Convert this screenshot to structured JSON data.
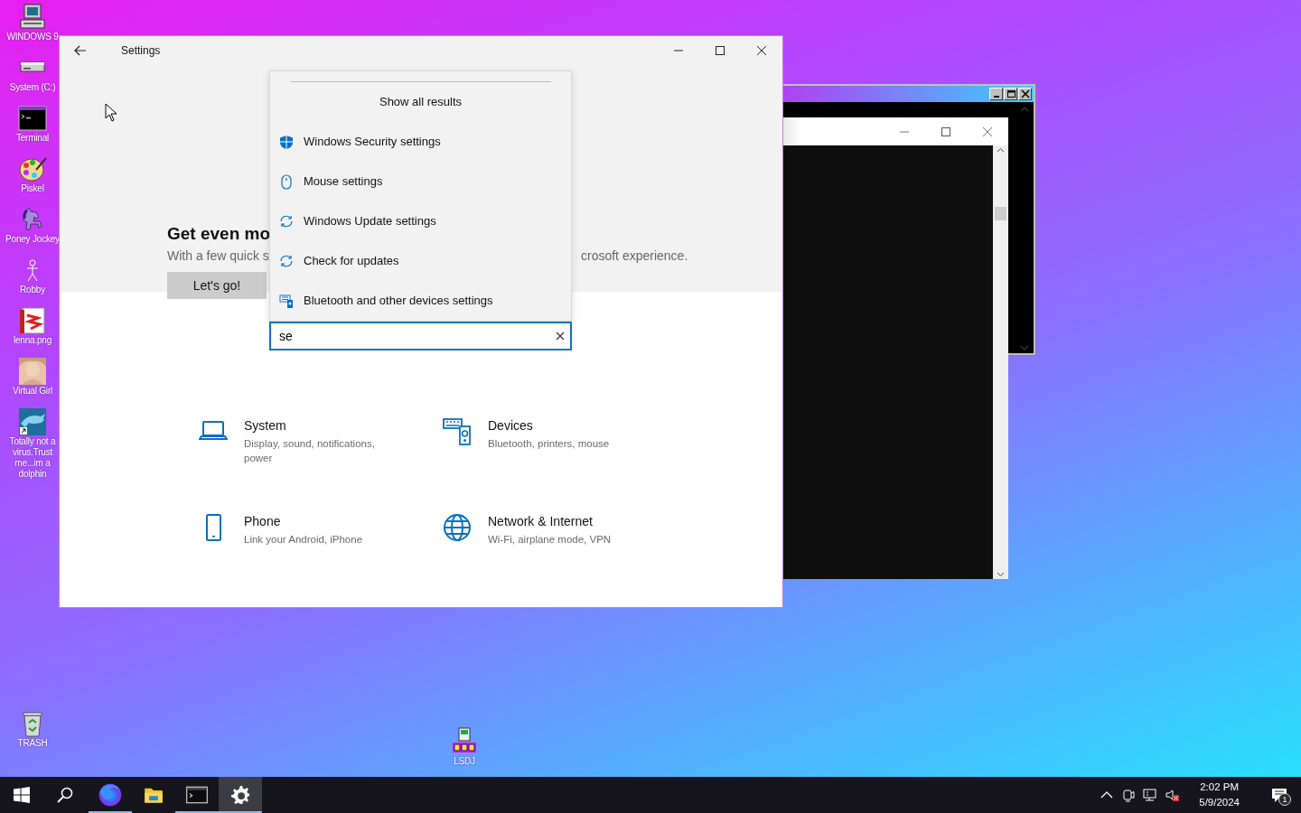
{
  "desktop_icons": [
    {
      "label": "WINDOWS 9",
      "kind": "computer"
    },
    {
      "label": "System (C:)",
      "kind": "drive"
    },
    {
      "label": "Terminal",
      "kind": "terminal"
    },
    {
      "label": "Piskel",
      "kind": "palette"
    },
    {
      "label": "Poney Jockey",
      "kind": "horse"
    },
    {
      "label": "Robby",
      "kind": "stick"
    },
    {
      "label": "lenna.png",
      "kind": "image"
    },
    {
      "label": "Virtual Girl",
      "kind": "person"
    },
    {
      "label": "Totally not a virus.Trust me...im a dolphin",
      "kind": "dolphin"
    }
  ],
  "bottom_icons": [
    {
      "label": "TRASH",
      "kind": "trash"
    },
    {
      "label": "LSDJ",
      "kind": "gameboy"
    }
  ],
  "settings": {
    "title": "Settings",
    "banner": {
      "heading": "Get even mo",
      "text_left": "With a few quick s",
      "text_right": "crosoft experience.",
      "button": "Let's go!"
    },
    "search": {
      "value": "se"
    },
    "results_header": "Show all results",
    "results": [
      {
        "label": "Windows Security settings",
        "kind": "shield"
      },
      {
        "label": "Mouse settings",
        "kind": "mouse"
      },
      {
        "label": "Windows Update settings",
        "kind": "sync"
      },
      {
        "label": "Check for updates",
        "kind": "sync"
      },
      {
        "label": "Bluetooth and other devices settings",
        "kind": "devices"
      }
    ],
    "categories": [
      {
        "title": "System",
        "subtitle": "Display, sound, notifications, power",
        "kind": "laptop"
      },
      {
        "title": "Devices",
        "subtitle": "Bluetooth, printers, mouse",
        "kind": "devices"
      },
      {
        "title": "Phone",
        "subtitle": "Link your Android, iPhone",
        "kind": "phone"
      },
      {
        "title": "Network & Internet",
        "subtitle": "Wi-Fi, airplane mode, VPN",
        "kind": "globe"
      }
    ]
  },
  "taskbar": {
    "apps": [
      {
        "kind": "start",
        "running": false,
        "selected": false
      },
      {
        "kind": "search",
        "running": false,
        "selected": false
      },
      {
        "kind": "browser",
        "running": true,
        "selected": false
      },
      {
        "kind": "folder",
        "running": false,
        "selected": false
      },
      {
        "kind": "terminal",
        "running": true,
        "selected": false
      },
      {
        "kind": "settings",
        "running": true,
        "selected": true
      }
    ],
    "time": "2:02 PM",
    "date": "5/9/2024",
    "notification_count": "1"
  }
}
